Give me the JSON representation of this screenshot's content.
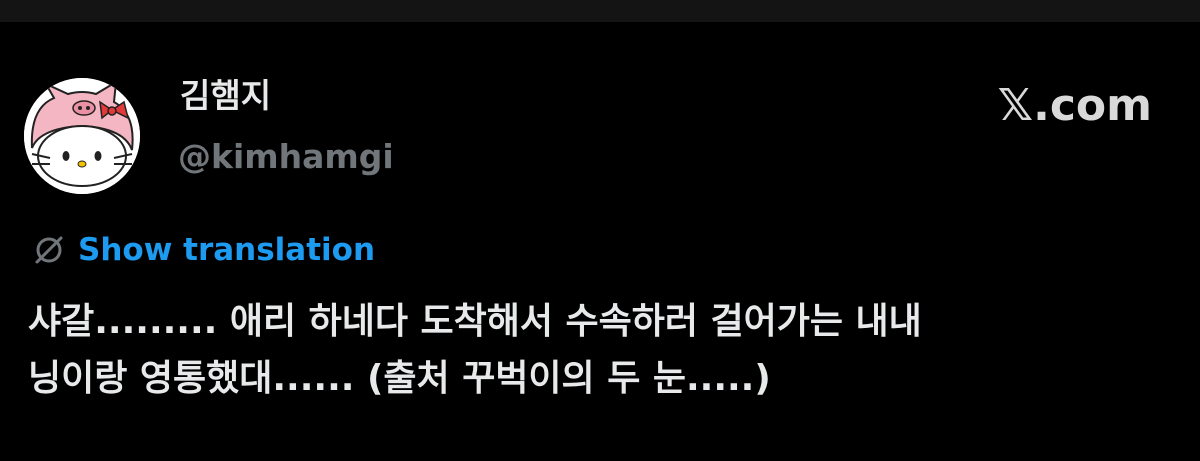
{
  "author": {
    "display_name": "김햄지",
    "handle": "@kimhamgi"
  },
  "brand": {
    "label": "𝕏.com"
  },
  "translation": {
    "label": "Show translation",
    "icon": "globe-slash-icon",
    "color": "#1d9bf0"
  },
  "tweet": {
    "line1": "샤갈......... 애리 하네다 도착해서 수속하러 걸어가는 내내",
    "line2": "닝이랑 영통했대...... (출처 꾸벅이의 두 눈.....)"
  },
  "colors": {
    "background": "#000000",
    "text": "#e7e9ea",
    "muted": "#71767b",
    "link": "#1d9bf0"
  }
}
